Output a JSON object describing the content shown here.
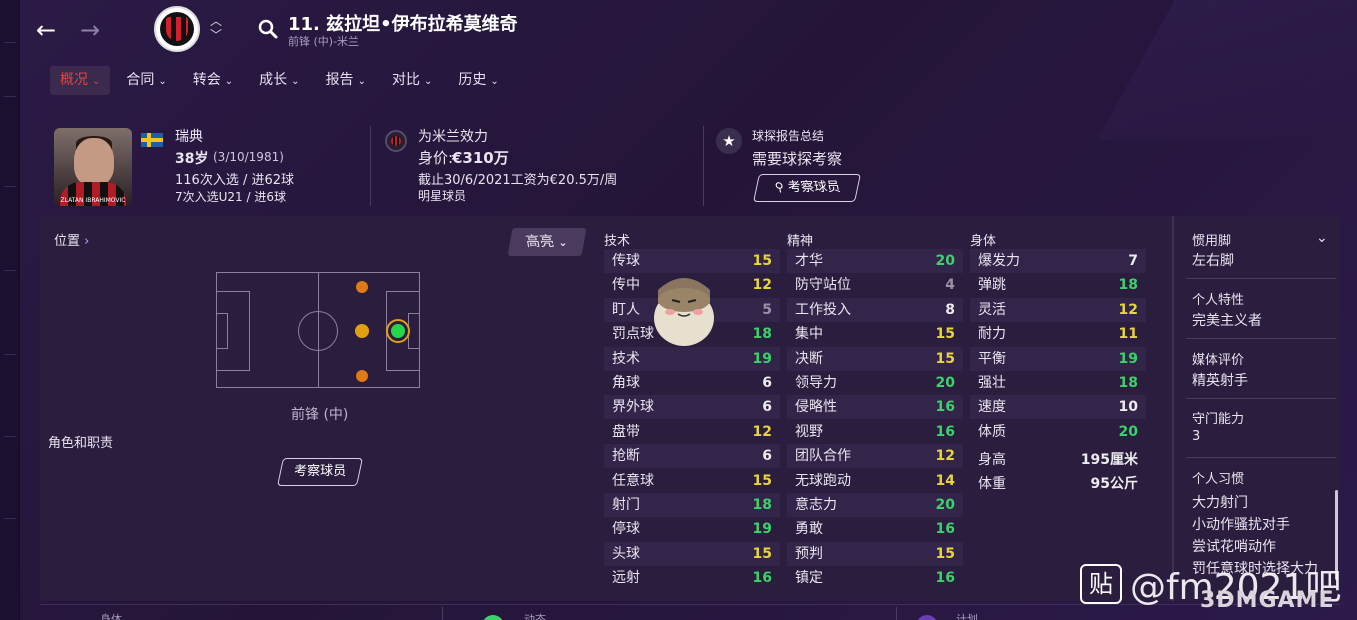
{
  "header": {
    "player_title": "11. 兹拉坦•伊布拉希莫维奇",
    "player_subtitle": "前锋 (中)-米兰",
    "back_icon": "arrow-left-icon",
    "forward_icon": "arrow-right-icon",
    "club_crest": "ac-milan-crest",
    "search_icon": "search-icon"
  },
  "tabs": [
    {
      "label": "概况",
      "active": true
    },
    {
      "label": "合同"
    },
    {
      "label": "转会"
    },
    {
      "label": "成长"
    },
    {
      "label": "报告"
    },
    {
      "label": "对比"
    },
    {
      "label": "历史"
    }
  ],
  "bio": {
    "photo_caption": "ZLATAN IBRAHIMOVIC",
    "nation": "瑞典",
    "age": "38岁",
    "dob": "(3/10/1981)",
    "caps": "116次入选 / 进62球",
    "u21": "7次入选U21 / 进6球"
  },
  "club": {
    "plays_for": "为米兰效力",
    "value_label": "身价:",
    "value": "€310万",
    "contract": "截止30/6/2021工资为€20.5万/周",
    "status": "明星球员"
  },
  "scout": {
    "title": "球探报告总结",
    "value": "需要球探考察",
    "button": "考察球员"
  },
  "position": {
    "label": "位置",
    "highlight_button": "高亮",
    "position_name": "前锋 (中)",
    "roles_label": "角色和职责",
    "scout_button": "考察球员"
  },
  "attributes": {
    "technical": {
      "title": "技术",
      "rows": [
        {
          "name": "传球",
          "value": "15",
          "tier": "y"
        },
        {
          "name": "传中",
          "value": "12",
          "tier": "y"
        },
        {
          "name": "盯人",
          "value": "5",
          "tier": "d"
        },
        {
          "name": "罚点球",
          "value": "18",
          "tier": "g"
        },
        {
          "name": "技术",
          "value": "19",
          "tier": "g"
        },
        {
          "name": "角球",
          "value": "6",
          "tier": "w"
        },
        {
          "name": "界外球",
          "value": "6",
          "tier": "w"
        },
        {
          "name": "盘带",
          "value": "12",
          "tier": "y"
        },
        {
          "name": "抢断",
          "value": "6",
          "tier": "w"
        },
        {
          "name": "任意球",
          "value": "15",
          "tier": "y"
        },
        {
          "name": "射门",
          "value": "18",
          "tier": "g"
        },
        {
          "name": "停球",
          "value": "19",
          "tier": "g"
        },
        {
          "name": "头球",
          "value": "15",
          "tier": "y"
        },
        {
          "name": "远射",
          "value": "16",
          "tier": "g"
        }
      ]
    },
    "mental": {
      "title": "精神",
      "rows": [
        {
          "name": "才华",
          "value": "20",
          "tier": "g"
        },
        {
          "name": "防守站位",
          "value": "4",
          "tier": "d"
        },
        {
          "name": "工作投入",
          "value": "8",
          "tier": "w"
        },
        {
          "name": "集中",
          "value": "15",
          "tier": "y"
        },
        {
          "name": "决断",
          "value": "15",
          "tier": "y"
        },
        {
          "name": "领导力",
          "value": "20",
          "tier": "g"
        },
        {
          "name": "侵略性",
          "value": "16",
          "tier": "g"
        },
        {
          "name": "视野",
          "value": "16",
          "tier": "g"
        },
        {
          "name": "团队合作",
          "value": "12",
          "tier": "y"
        },
        {
          "name": "无球跑动",
          "value": "14",
          "tier": "y"
        },
        {
          "name": "意志力",
          "value": "20",
          "tier": "g"
        },
        {
          "name": "勇敢",
          "value": "16",
          "tier": "g"
        },
        {
          "name": "预判",
          "value": "15",
          "tier": "y"
        },
        {
          "name": "镇定",
          "value": "16",
          "tier": "g"
        }
      ]
    },
    "physical": {
      "title": "身体",
      "rows": [
        {
          "name": "爆发力",
          "value": "7",
          "tier": "w"
        },
        {
          "name": "弹跳",
          "value": "18",
          "tier": "g"
        },
        {
          "name": "灵活",
          "value": "12",
          "tier": "y"
        },
        {
          "name": "耐力",
          "value": "11",
          "tier": "y"
        },
        {
          "name": "平衡",
          "value": "19",
          "tier": "g"
        },
        {
          "name": "强壮",
          "value": "18",
          "tier": "g"
        },
        {
          "name": "速度",
          "value": "10",
          "tier": "w"
        },
        {
          "name": "体质",
          "value": "20",
          "tier": "g"
        }
      ],
      "height_label": "身高",
      "height": "195厘米",
      "weight_label": "体重",
      "weight": "95公斤"
    }
  },
  "sidebar": {
    "foot_label": "惯用脚",
    "foot": "左右脚",
    "trait_label": "个人特性",
    "trait": "完美主义者",
    "media_label": "媒体评价",
    "media": "精英射手",
    "gk_label": "守门能力",
    "gk": "3",
    "habits_label": "个人习惯",
    "habits": [
      "大力射门",
      "小动作骚扰对手",
      "尝试花哨动作",
      "罚任意球时选择大力"
    ]
  },
  "bottom": {
    "tab1": "身体",
    "tab2": "动态",
    "tab3": "计划"
  },
  "watermark": {
    "tieba": "贴",
    "handle": "@fm2021吧",
    "site": "3DMGAME"
  },
  "colors": {
    "green": "#39d36a",
    "yellow": "#e8d53a",
    "accent_red": "#e2453b"
  }
}
